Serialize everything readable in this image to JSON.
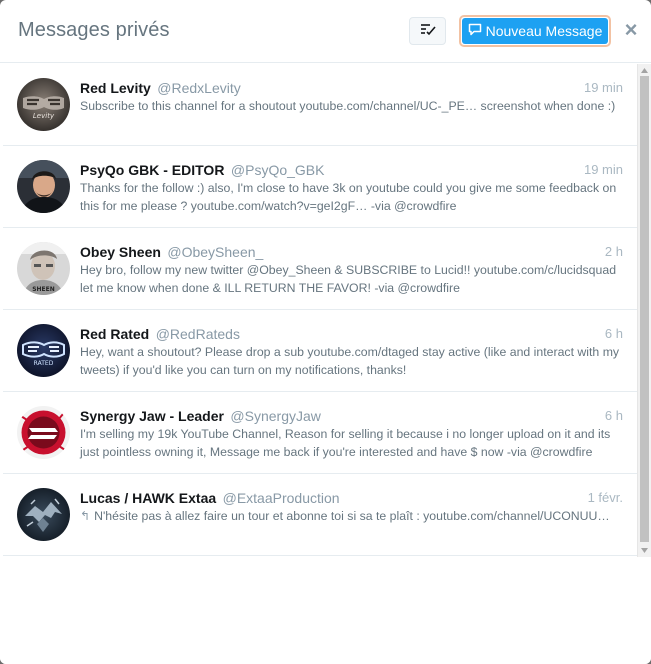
{
  "header": {
    "title": "Messages privés",
    "mark_all_read_icon": "check-list-icon",
    "new_message_label": "Nouveau Message",
    "new_message_icon": "compose-icon",
    "close_icon": "close-icon",
    "close_glyph": "×"
  },
  "colors": {
    "accent": "#1da1f2",
    "text_primary": "#14171a",
    "text_secondary": "#66757f",
    "muted": "#8899a6"
  },
  "conversations": [
    {
      "name": "Red Levity",
      "username": "@RedxLevity",
      "time": "19 min",
      "snippet": "Subscribe to this channel for a shoutout youtube.com/channel/UC-_PE… screenshot when done :)",
      "reply": false
    },
    {
      "name": "PsyQo GBK - EDITOR",
      "username": "@PsyQo_GBK",
      "time": "19 min",
      "snippet": "Thanks for the follow :) also, I'm close to have 3k on youtube could you give me some feedback on this for me please ? youtube.com/watch?v=geI2gF… -via @crowdfire",
      "reply": false
    },
    {
      "name": "Obey Sheen",
      "username": "@ObeySheen_",
      "time": "2 h",
      "snippet": "Hey bro, follow my new twitter @Obey_Sheen & SUBSCRIBE to Lucid!! youtube.com/c/lucidsquad let me know when done & ILL RETURN THE FAVOR! -via @crowdfire",
      "reply": false
    },
    {
      "name": "Red Rated",
      "username": "@RedRateds",
      "time": "6 h",
      "snippet": "Hey, want a shoutout? Please drop a sub youtube.com/dtaged stay active (like and interact with my tweets) if you'd like you can turn on my notifications, thanks!",
      "reply": false
    },
    {
      "name": "Synergy Jaw - Leader",
      "username": "@SynergyJaw",
      "time": "6 h",
      "snippet": "I'm selling my 19k YouTube Channel, Reason for selling it because i no longer upload on it and its just pointless owning it, Message me back if you're interested and have $ now -via @crowdfire",
      "reply": false
    },
    {
      "name": "Lucas / HAWK Extaa",
      "username": "@ExtaaProduction",
      "time": "1 févr.",
      "snippet": "N'hésite pas à allez faire un tour et abonne toi si sa te plaît : youtube.com/channel/UCONUU…",
      "reply": true,
      "reply_glyph": "↰"
    }
  ],
  "avatars": {
    "red_levity": "Levity",
    "obey_sheen": "SHEEN",
    "red_rated": "RATED"
  }
}
